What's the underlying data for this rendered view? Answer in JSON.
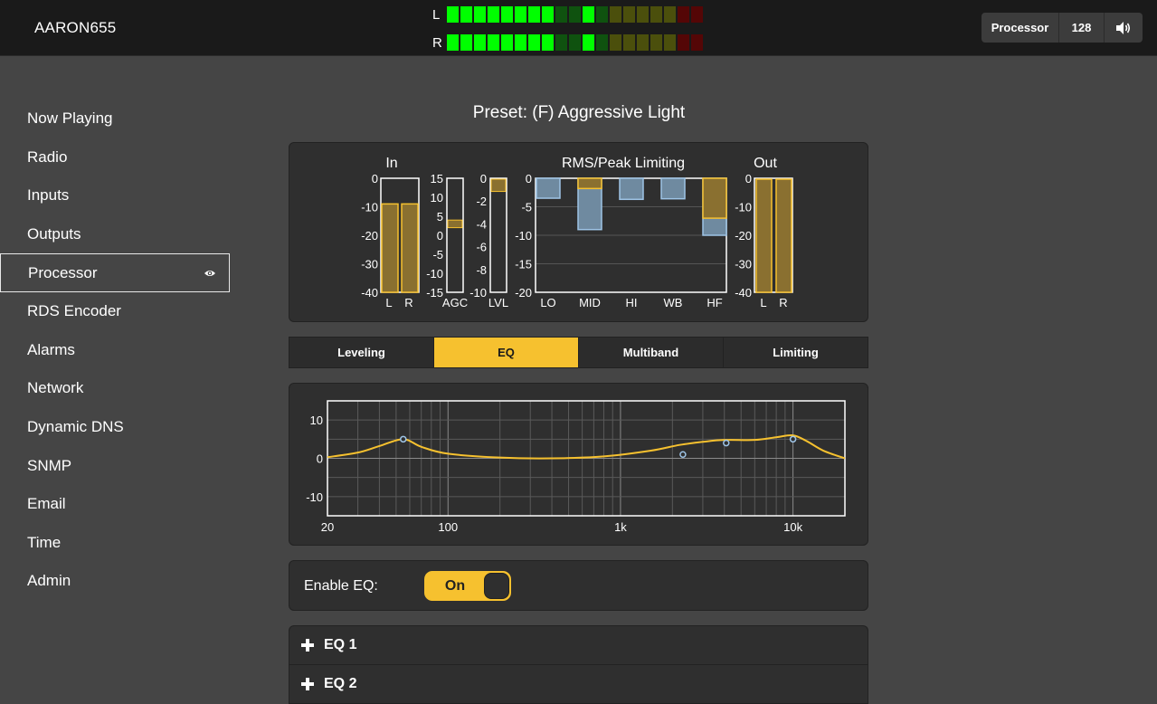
{
  "header": {
    "brand": "AARON655",
    "meter_left_label": "L",
    "meter_right_label": "R",
    "meter_colors": [
      "#00ff00",
      "#00ff00",
      "#00ff00",
      "#00ff00",
      "#00ff00",
      "#00ff00",
      "#00ff00",
      "#00ff00",
      "#0f520f",
      "#0f520f",
      "#00ff00",
      "#0f520f",
      "#4b4f0c",
      "#4b4f0c",
      "#4b4f0c",
      "#4b4f0c",
      "#4b4f0c",
      "#540606",
      "#540606"
    ],
    "processor_label": "Processor",
    "bitrate": "128",
    "volume_icon": "speaker-icon"
  },
  "sidebar": {
    "items": [
      {
        "label": "Now Playing"
      },
      {
        "label": "Radio"
      },
      {
        "label": "Inputs"
      },
      {
        "label": "Outputs"
      },
      {
        "label": "Processor",
        "active": true
      },
      {
        "label": "RDS Encoder"
      },
      {
        "label": "Alarms"
      },
      {
        "label": "Network"
      },
      {
        "label": "Dynamic DNS"
      },
      {
        "label": "SNMP"
      },
      {
        "label": "Email"
      },
      {
        "label": "Time"
      },
      {
        "label": "Admin"
      }
    ],
    "active_icon": "eye-icon"
  },
  "main": {
    "preset_title": "Preset: (F) Aggressive Light",
    "meters": {
      "in_title": "In",
      "rms_title": "RMS/Peak Limiting",
      "out_title": "Out",
      "in_ticks": [
        "0",
        "-10",
        "-20",
        "-30",
        "-40"
      ],
      "in_labels": [
        "L",
        "R"
      ],
      "in_levels": [
        -9,
        -9
      ],
      "agc_ticks": [
        "15",
        "10",
        "5",
        "0",
        "-5",
        "-10",
        "-15"
      ],
      "agc_label": "AGC",
      "agc_range": [
        2,
        4
      ],
      "lvl_ticks": [
        "0",
        "-2",
        "-4",
        "-6",
        "-8",
        "-10"
      ],
      "lvl_label": "LVL",
      "lvl_level": -0.6,
      "rms_ticks": [
        "0",
        "-5",
        "-10",
        "-15",
        "-20"
      ],
      "bands": [
        {
          "label": "LO",
          "rms": -3.5,
          "peak": 0
        },
        {
          "label": "MID",
          "rms": -9,
          "peak": -1.8
        },
        {
          "label": "HI",
          "rms": -3.7,
          "peak": 0
        },
        {
          "label": "WB",
          "rms": -3.6,
          "peak": 0
        },
        {
          "label": "HF",
          "rms": -10,
          "peak": -7
        }
      ],
      "out_ticks": [
        "0",
        "-10",
        "-20",
        "-30",
        "-40"
      ],
      "out_labels": [
        "L",
        "R"
      ],
      "out_levels": [
        0,
        0
      ]
    },
    "tabs": [
      {
        "label": "Leveling"
      },
      {
        "label": "EQ",
        "active": true
      },
      {
        "label": "Multiband"
      },
      {
        "label": "Limiting"
      }
    ],
    "eq_graph": {
      "y_ticks": [
        "10",
        "0",
        "-10"
      ],
      "x_ticks": [
        "20",
        "100",
        "1k",
        "10k"
      ],
      "ylim": [
        -15,
        15
      ],
      "xlim_hz": [
        20,
        20000
      ],
      "curve": [
        [
          20,
          0.3
        ],
        [
          30,
          1.5
        ],
        [
          40,
          3.2
        ],
        [
          55,
          5
        ],
        [
          70,
          3
        ],
        [
          100,
          1.2
        ],
        [
          200,
          0.2
        ],
        [
          400,
          0
        ],
        [
          800,
          0.5
        ],
        [
          1500,
          2
        ],
        [
          2200,
          3.5
        ],
        [
          3000,
          4.3
        ],
        [
          4000,
          4.8
        ],
        [
          6000,
          4.8
        ],
        [
          8000,
          5.5
        ],
        [
          10000,
          6
        ],
        [
          12000,
          4.5
        ],
        [
          15000,
          2
        ],
        [
          20000,
          0
        ]
      ],
      "points": [
        [
          55,
          5
        ],
        [
          2300,
          1
        ],
        [
          4100,
          4
        ],
        [
          10000,
          5
        ]
      ]
    },
    "enable_eq_label": "Enable EQ:",
    "enable_eq_value": "On",
    "accordion": [
      {
        "label": "EQ 1",
        "icon": "plus-icon"
      },
      {
        "label": "EQ 2",
        "icon": "plus-icon"
      }
    ]
  }
}
